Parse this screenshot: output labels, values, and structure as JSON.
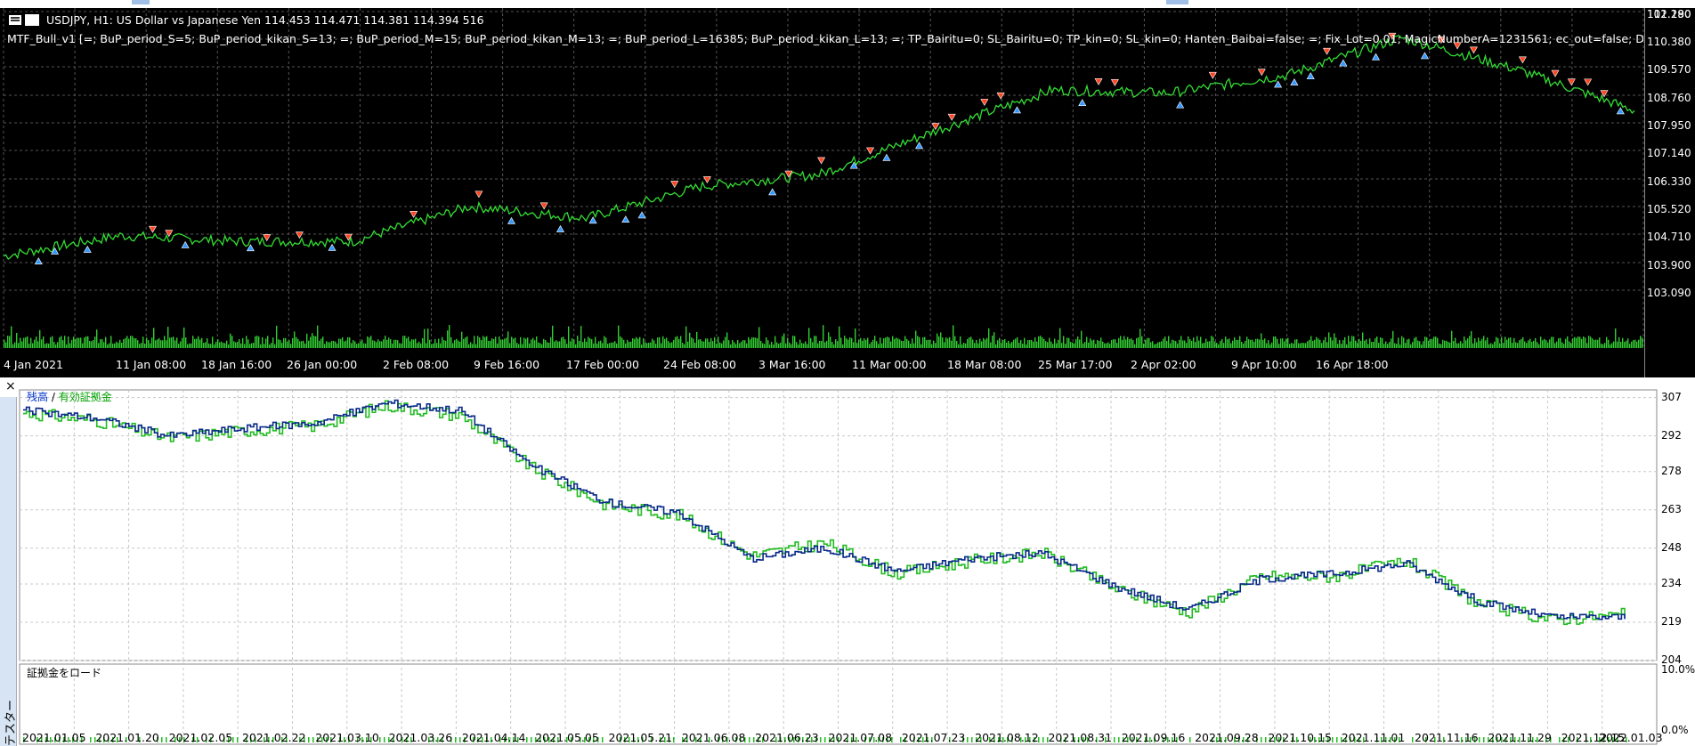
{
  "top_chart": {
    "symbol_line": "USDJPY, H1:  US Dollar vs Japanese Yen  114.453 114.471 114.381 114.394  516",
    "indicator_line": "MTF_Bull_v1 [=; BuP_period_S=5; BuP_period_kikan_S=13; =; BuP_period_M=15; BuP_period_kikan_M=13; =; BuP_period_L=16385; BuP_period_kikan_L=13; =; TP_Bairitu=0; SL_Bairitu=0; TP_kin=0; SL_kin=0; Hanten_Baibai=false; =; Fix_Lot=0.01; MagicNumberA=1231561; ec_out=false; DamiDami=false; =; =; Custom_out=",
    "price_labels": [
      "111.190",
      "110.380",
      "109.570",
      "108.760",
      "107.950",
      "107.140",
      "106.330",
      "105.520",
      "104.710",
      "103.900",
      "103.090",
      "102.280"
    ],
    "time_labels": [
      "4 Jan 2021",
      "11 Jan 08:00",
      "18 Jan 16:00",
      "26 Jan 00:00",
      "2 Feb 08:00",
      "9 Feb 16:00",
      "17 Feb 00:00",
      "24 Feb 08:00",
      "3 Mar 16:00",
      "11 Mar 00:00",
      "18 Mar 08:00",
      "25 Mar 17:00",
      "2 Apr 02:00",
      "9 Apr 10:00",
      "16 Apr 18:00"
    ],
    "colors": {
      "background": "#000000",
      "price_line": "#33dd33",
      "grid": "#555555",
      "sell_arrow": "#ff4422",
      "buy_arrow": "#3399ff",
      "volume": "#33cc33"
    }
  },
  "tester": {
    "close_label": "×",
    "vertical_tab_label": "テスター",
    "legend_balance": "残高",
    "legend_sep": " / ",
    "legend_equity": "有効証拠金",
    "y_labels": [
      "307",
      "292",
      "278",
      "263",
      "248",
      "234",
      "219",
      "204"
    ],
    "load_title": "証拠金をロード",
    "load_y_labels": [
      "10.0%",
      "0.0%"
    ],
    "x_labels": [
      "2021.01.05",
      "2021.01.20",
      "2021.02.05",
      "2021.02.22",
      "2021.03.10",
      "2021.03.26",
      "2021.04.14",
      "2021.05.05",
      "2021.05.21",
      "2021.06.08",
      "2021.06.23",
      "2021.07.08",
      "2021.07.23",
      "2021.08.12",
      "2021.08.31",
      "2021.09.16",
      "2021.09.28",
      "2021.10.15",
      "2021.11.01",
      "2021.11.16",
      "2021.11.29",
      "2021.12.15",
      "2022.01.03"
    ],
    "colors": {
      "balance": "#0a2a8a",
      "equity": "#22bb22",
      "grid": "#c8c8c8"
    }
  },
  "chart_data": [
    {
      "type": "line",
      "title": "USDJPY, H1",
      "xlabel": "",
      "ylabel": "",
      "ylim": [
        101.87,
        111.6
      ],
      "categories": [
        "4 Jan 2021",
        "11 Jan 08:00",
        "18 Jan 16:00",
        "26 Jan 00:00",
        "2 Feb 08:00",
        "9 Feb 16:00",
        "17 Feb 00:00",
        "24 Feb 08:00",
        "3 Mar 16:00",
        "11 Mar 00:00",
        "18 Mar 08:00",
        "25 Mar 17:00",
        "2 Apr 02:00",
        "9 Apr 10:00",
        "16 Apr 18:00"
      ],
      "series": [
        {
          "name": "USDJPY",
          "values": [
            103.2,
            103.9,
            103.7,
            103.7,
            104.9,
            104.5,
            105.6,
            106.0,
            107.5,
            108.9,
            108.8,
            109.4,
            110.7,
            109.6,
            108.2
          ]
        }
      ]
    },
    {
      "type": "line",
      "title": "",
      "xlabel": "",
      "ylabel": "",
      "ylim": [
        204,
        310
      ],
      "categories": [
        "2021.01.05",
        "2021.01.20",
        "2021.02.05",
        "2021.02.22",
        "2021.03.10",
        "2021.03.26",
        "2021.04.14",
        "2021.05.05",
        "2021.05.21",
        "2021.06.08",
        "2021.06.23",
        "2021.07.08",
        "2021.07.23",
        "2021.08.12",
        "2021.08.31",
        "2021.09.16",
        "2021.09.28",
        "2021.10.15",
        "2021.11.01",
        "2021.11.16",
        "2021.11.29",
        "2021.12.15",
        "2022.01.03"
      ],
      "series": [
        {
          "name": "残高",
          "values": [
            302,
            299,
            292,
            295,
            297,
            305,
            302,
            280,
            266,
            262,
            244,
            248,
            239,
            244,
            246,
            233,
            224,
            236,
            238,
            242,
            227,
            221,
            221
          ]
        },
        {
          "name": "有効証拠金",
          "values": [
            301,
            298,
            291,
            294,
            296,
            304,
            300,
            279,
            265,
            261,
            245,
            250,
            238,
            243,
            246,
            232,
            223,
            237,
            237,
            243,
            226,
            220,
            222
          ]
        }
      ]
    }
  ]
}
